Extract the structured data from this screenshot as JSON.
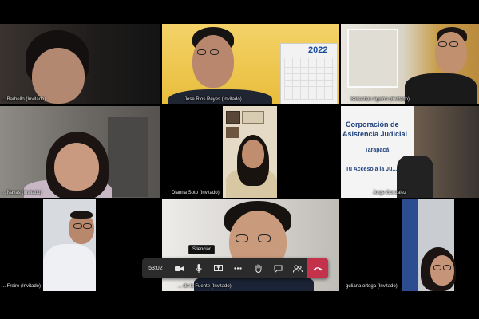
{
  "participants": [
    {
      "name": "... Barbello (Invitado)"
    },
    {
      "name": "Jose Rios Reyes (Invitado)"
    },
    {
      "name": "Sebastian Aguirre (Invitado)"
    },
    {
      "name": "... Navas (Invitado)"
    },
    {
      "name": "Dianna Soto (Invitado)"
    },
    {
      "name": "Jorge Gonzalez"
    },
    {
      "name": "... Freire (Invitado)"
    },
    {
      "name": "... de la Fuente (Invitado)"
    },
    {
      "name": "guliana ortega (Invitado)"
    }
  ],
  "calendar": {
    "year": "2022"
  },
  "sign": {
    "line1": "Corporación de",
    "line2": "Asistencia Judicial",
    "line3": "Tarapacá",
    "line4": "Tu Acceso a la Ju..."
  },
  "toolbar": {
    "time": "53:02",
    "tooltip": "Silenciar",
    "icons": [
      "camera-icon",
      "microphone-icon",
      "share-screen-icon",
      "more-icon",
      "raise-hand-icon",
      "chat-icon",
      "participants-icon",
      "leave-call-icon"
    ]
  },
  "colors": {
    "leave": "#c4314b",
    "toolbar": "#2b2b2b",
    "sign_text": "#1d3f7a",
    "yellow_wall": "#f0c94a"
  }
}
